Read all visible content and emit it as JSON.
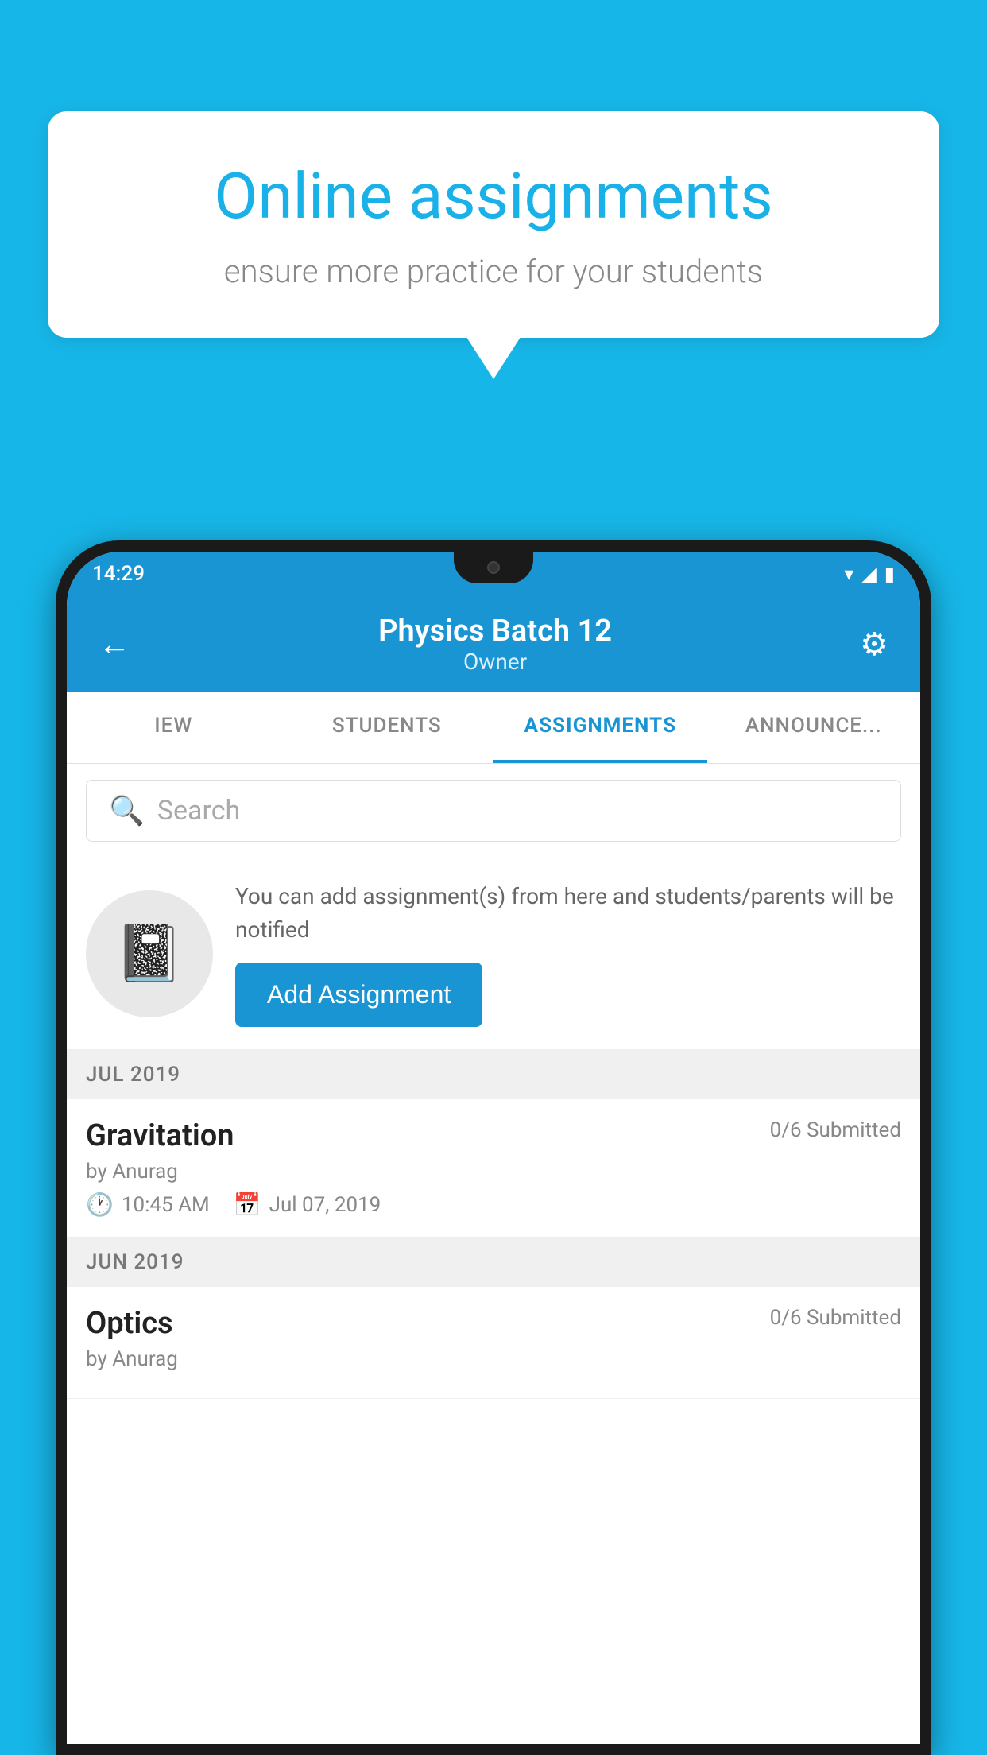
{
  "background_color": "#17b6e8",
  "speech_bubble": {
    "title": "Online assignments",
    "subtitle": "ensure more practice for your students"
  },
  "status_bar": {
    "time": "14:29"
  },
  "app_header": {
    "title": "Physics Batch 12",
    "subtitle": "Owner"
  },
  "tabs": [
    {
      "label": "IEW",
      "active": false
    },
    {
      "label": "STUDENTS",
      "active": false
    },
    {
      "label": "ASSIGNMENTS",
      "active": true
    },
    {
      "label": "ANNOUNCEMENTS",
      "active": false
    }
  ],
  "search": {
    "placeholder": "Search"
  },
  "promo": {
    "text": "You can add assignment(s) from here and students/parents will be notified",
    "button_label": "Add Assignment"
  },
  "sections": [
    {
      "label": "JUL 2019",
      "assignments": [
        {
          "title": "Gravitation",
          "submitted": "0/6 Submitted",
          "by": "by Anurag",
          "time": "10:45 AM",
          "date": "Jul 07, 2019"
        }
      ]
    },
    {
      "label": "JUN 2019",
      "assignments": [
        {
          "title": "Optics",
          "submitted": "0/6 Submitted",
          "by": "by Anurag",
          "time": "",
          "date": ""
        }
      ]
    }
  ]
}
